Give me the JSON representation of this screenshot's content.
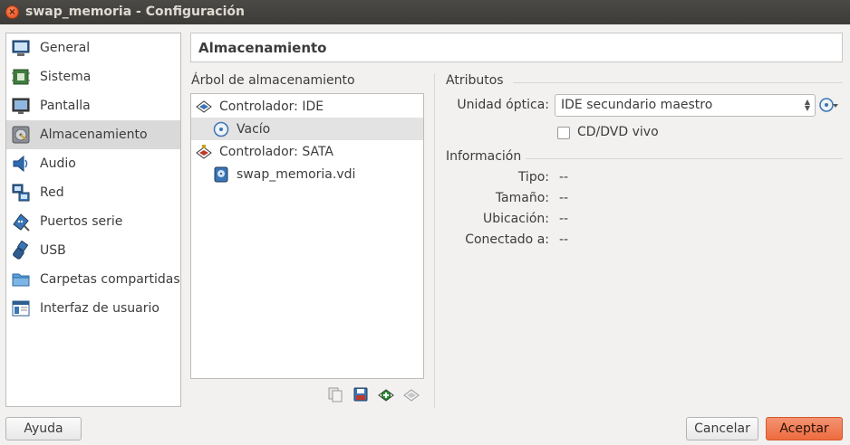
{
  "window": {
    "title": "swap_memoria - Configuración",
    "close_glyph": "×"
  },
  "sidebar": {
    "items": [
      {
        "label": "General",
        "icon": "monitor-icon"
      },
      {
        "label": "Sistema",
        "icon": "chip-icon"
      },
      {
        "label": "Pantalla",
        "icon": "display-icon"
      },
      {
        "label": "Almacenamiento",
        "icon": "disk-icon"
      },
      {
        "label": "Audio",
        "icon": "speaker-icon"
      },
      {
        "label": "Red",
        "icon": "network-icon"
      },
      {
        "label": "Puertos serie",
        "icon": "serial-port-icon"
      },
      {
        "label": "USB",
        "icon": "usb-icon"
      },
      {
        "label": "Carpetas compartidas",
        "icon": "folder-icon"
      },
      {
        "label": "Interfaz de usuario",
        "icon": "ui-icon"
      }
    ],
    "selected": "Almacenamiento"
  },
  "header": {
    "title": "Almacenamiento"
  },
  "tree": {
    "label": "Árbol de almacenamiento",
    "rows": [
      {
        "label": "Controlador: IDE",
        "icon": "ide-controller-icon"
      },
      {
        "label": "Vacío",
        "icon": "optical-disc-icon"
      },
      {
        "label": "Controlador: SATA",
        "icon": "sata-controller-icon"
      },
      {
        "label": "swap_memoria.vdi",
        "icon": "hard-disk-icon"
      }
    ],
    "selected": "Vacío"
  },
  "attributes": {
    "title": "Atributos",
    "optical_label": "Unidad óptica:",
    "optical_value": "IDE secundario maestro",
    "live_cd_label": "CD/DVD vivo",
    "live_cd_checked": false
  },
  "info": {
    "title": "Información",
    "rows": [
      {
        "label": "Tipo:",
        "value": "--"
      },
      {
        "label": "Tamaño:",
        "value": "--"
      },
      {
        "label": "Ubicación:",
        "value": "--"
      },
      {
        "label": "Conectado a:",
        "value": "--"
      }
    ]
  },
  "buttons": {
    "help": "Ayuda",
    "cancel": "Cancelar",
    "accept": "Aceptar"
  },
  "colors": {
    "accent": "#ee6b3f",
    "selection": "#d9d9d9",
    "titlebar": "#3c3b37"
  }
}
